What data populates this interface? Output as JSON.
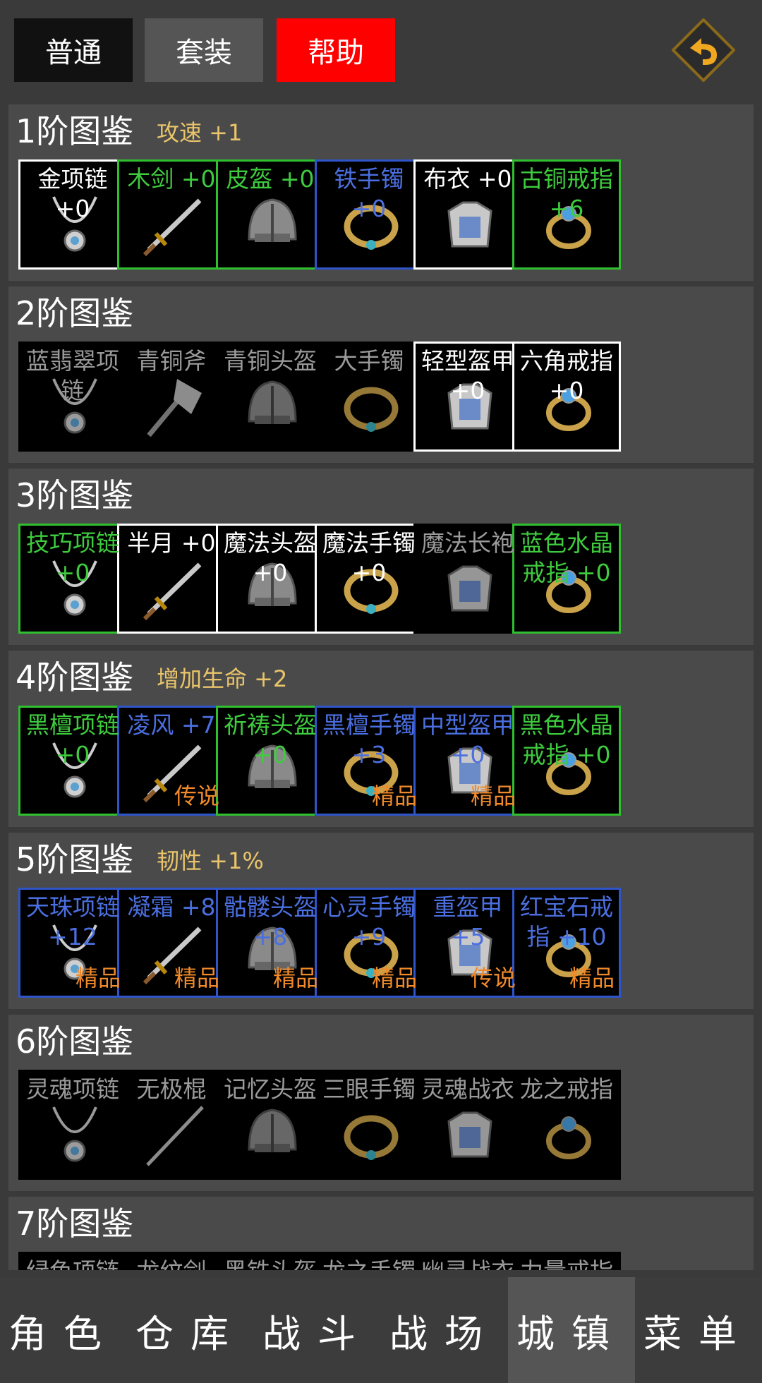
{
  "top_tabs": [
    {
      "label": "普通"
    },
    {
      "label": "套装"
    },
    {
      "label": "帮助"
    }
  ],
  "back_icon": "back-arrow-icon",
  "sections": [
    {
      "title": "1阶图鉴",
      "bonus": "攻速 +1",
      "items": [
        {
          "name": "金项链 +0",
          "border": "white",
          "text": "white",
          "icon": "necklace-icon"
        },
        {
          "name": "木剑 +0",
          "border": "green",
          "text": "green",
          "icon": "sword-icon"
        },
        {
          "name": "皮盔 +0",
          "border": "green",
          "text": "green",
          "icon": "helmet-icon"
        },
        {
          "name": "铁手镯 +0",
          "border": "blue",
          "text": "blue",
          "icon": "bracelet-icon"
        },
        {
          "name": "布衣 +0",
          "border": "white",
          "text": "white",
          "icon": "armor-icon"
        },
        {
          "name": "古铜戒指 +6",
          "border": "green",
          "text": "green",
          "icon": "ring-icon"
        }
      ]
    },
    {
      "title": "2阶图鉴",
      "bonus": "",
      "items": [
        {
          "name": "蓝翡翠项链",
          "border": "none",
          "text": "gray",
          "icon": "necklace-icon"
        },
        {
          "name": "青铜斧",
          "border": "none",
          "text": "gray",
          "icon": "axe-icon"
        },
        {
          "name": "青铜头盔",
          "border": "none",
          "text": "gray",
          "icon": "helmet-icon"
        },
        {
          "name": "大手镯",
          "border": "none",
          "text": "gray",
          "icon": "bracelet-icon"
        },
        {
          "name": "轻型盔甲 +0",
          "border": "white",
          "text": "white",
          "icon": "armor-icon"
        },
        {
          "name": "六角戒指 +0",
          "border": "white",
          "text": "white",
          "icon": "ring-icon"
        }
      ]
    },
    {
      "title": "3阶图鉴",
      "bonus": "",
      "items": [
        {
          "name": "技巧项链 +0",
          "border": "green",
          "text": "green",
          "icon": "necklace-icon"
        },
        {
          "name": "半月 +0",
          "border": "white",
          "text": "white",
          "icon": "sword-icon"
        },
        {
          "name": "魔法头盔 +0",
          "border": "white",
          "text": "white",
          "icon": "helmet-icon"
        },
        {
          "name": "魔法手镯 +0",
          "border": "white",
          "text": "white",
          "icon": "bracelet-icon"
        },
        {
          "name": "魔法长袍",
          "border": "none",
          "text": "gray",
          "icon": "armor-icon"
        },
        {
          "name": "蓝色水晶戒指 +0",
          "border": "green",
          "text": "green",
          "icon": "ring-icon"
        }
      ]
    },
    {
      "title": "4阶图鉴",
      "bonus": "增加生命 +2",
      "items": [
        {
          "name": "黑檀项链 +0",
          "border": "green",
          "text": "green",
          "icon": "necklace-icon"
        },
        {
          "name": "凌风 +7",
          "border": "blue",
          "text": "blue",
          "icon": "sword-icon",
          "quality": "传说"
        },
        {
          "name": "祈祷头盔 +0",
          "border": "green",
          "text": "green",
          "icon": "helmet-icon"
        },
        {
          "name": "黑檀手镯 +3",
          "border": "blue",
          "text": "blue",
          "icon": "bracelet-icon",
          "quality": "精品"
        },
        {
          "name": "中型盔甲 +0",
          "border": "blue",
          "text": "blue",
          "icon": "armor-icon",
          "quality": "精品"
        },
        {
          "name": "黑色水晶戒指 +0",
          "border": "green",
          "text": "green",
          "icon": "ring-icon"
        }
      ]
    },
    {
      "title": "5阶图鉴",
      "bonus": "韧性 +1%",
      "items": [
        {
          "name": "天珠项链 +12",
          "border": "blue",
          "text": "blue",
          "icon": "necklace-icon",
          "quality": "精品"
        },
        {
          "name": "凝霜 +8",
          "border": "blue",
          "text": "blue",
          "icon": "sword-icon",
          "quality": "精品"
        },
        {
          "name": "骷髅头盔 +8",
          "border": "blue",
          "text": "blue",
          "icon": "helmet-icon",
          "quality": "精品"
        },
        {
          "name": "心灵手镯 +9",
          "border": "blue",
          "text": "blue",
          "icon": "bracelet-icon",
          "quality": "精品"
        },
        {
          "name": "重盔甲 +5",
          "border": "blue",
          "text": "blue",
          "icon": "armor-icon",
          "quality": "传说"
        },
        {
          "name": "红宝石戒指 +10",
          "border": "blue",
          "text": "blue",
          "icon": "ring-icon",
          "quality": "精品"
        }
      ]
    },
    {
      "title": "6阶图鉴",
      "bonus": "",
      "items": [
        {
          "name": "灵魂项链",
          "border": "none",
          "text": "gray",
          "icon": "necklace-icon"
        },
        {
          "name": "无极棍",
          "border": "none",
          "text": "gray",
          "icon": "staff-icon"
        },
        {
          "name": "记忆头盔",
          "border": "none",
          "text": "gray",
          "icon": "helmet-icon"
        },
        {
          "name": "三眼手镯",
          "border": "none",
          "text": "gray",
          "icon": "bracelet-icon"
        },
        {
          "name": "灵魂战衣",
          "border": "none",
          "text": "gray",
          "icon": "armor-icon"
        },
        {
          "name": "龙之戒指",
          "border": "none",
          "text": "gray",
          "icon": "ring-icon"
        }
      ]
    },
    {
      "title": "7阶图鉴",
      "bonus": "",
      "items": [
        {
          "name": "绿色项链",
          "border": "none",
          "text": "gray",
          "icon": "necklace-icon"
        },
        {
          "name": "龙纹剑",
          "border": "none",
          "text": "gray",
          "icon": "sword-icon"
        },
        {
          "name": "黑铁头盔",
          "border": "none",
          "text": "gray",
          "icon": "helmet-icon"
        },
        {
          "name": "龙之手镯",
          "border": "none",
          "text": "gray",
          "icon": "bracelet-icon"
        },
        {
          "name": "幽灵战衣",
          "border": "none",
          "text": "gray",
          "icon": "armor-icon"
        },
        {
          "name": "力量戒指",
          "border": "none",
          "text": "gray",
          "icon": "ring-icon"
        }
      ]
    }
  ],
  "bottom_nav": [
    {
      "label": "角色"
    },
    {
      "label": "仓库"
    },
    {
      "label": "战斗"
    },
    {
      "label": "战场"
    },
    {
      "label": "城镇",
      "active": true
    },
    {
      "label": "菜单"
    }
  ],
  "colors": {
    "help_tab": "#ff0000",
    "bonus_text": "#e9c46a",
    "quality_text": "#f08a2a"
  }
}
